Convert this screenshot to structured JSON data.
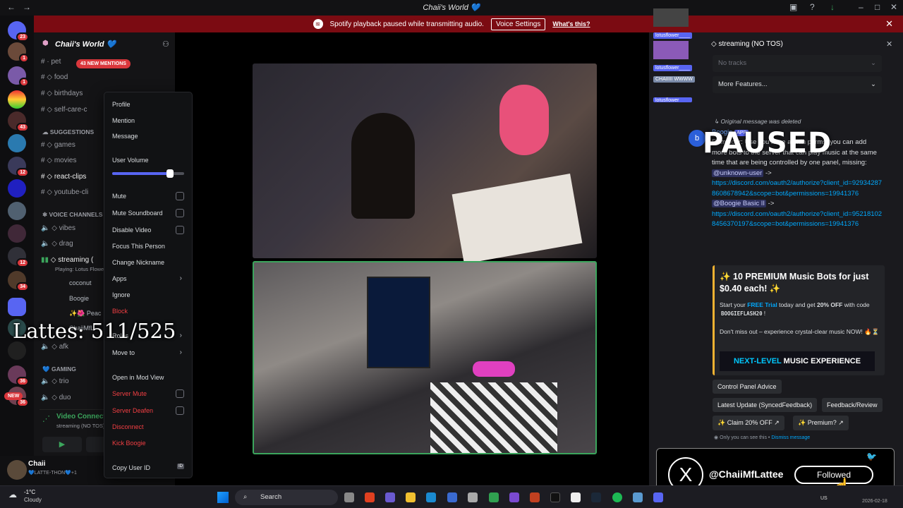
{
  "titlebar": {
    "title": "Chaii's World 💙"
  },
  "notice": {
    "text": "Spotify playback paused while transmitting audio.",
    "button": "Voice Settings",
    "link": "What's this?"
  },
  "server": {
    "name": "Chaii's World 💙",
    "mentions": "43 NEW MENTIONS"
  },
  "rail_badges": [
    "23",
    "1",
    "1",
    "43",
    "12",
    "12",
    "34",
    "36",
    "36",
    "NEW"
  ],
  "channels": {
    "text": [
      "pet",
      "food",
      "birthdays",
      "self-care-c"
    ],
    "cat_suggestions": "SUGGESTIONS",
    "suggestions": [
      "games",
      "movies",
      "react-clips",
      "youtube-cli"
    ],
    "cat_voice": "VOICE CHANNELS",
    "voice": [
      "vibes",
      "drag",
      "streaming (",
      "afk"
    ],
    "streaming_sub": "Playing: Lotus Flowe",
    "users": [
      "coconut",
      "Boogie",
      "✨🌺 Peac",
      "ChaiiMfL"
    ],
    "cat_gaming": "GAMING",
    "gaming": [
      "trio",
      "duo"
    ]
  },
  "voice_connected": {
    "title": "Video Connected",
    "sub": "streaming (NO TOS) / Chai"
  },
  "user": {
    "name": "Chaii",
    "status": "💙LATTE-THON💙+1"
  },
  "menu": {
    "profile": "Profile",
    "mention": "Mention",
    "message": "Message",
    "user_volume": "User Volume",
    "volume": 0.8,
    "mute": "Mute",
    "mute_soundboard": "Mute Soundboard",
    "disable_video": "Disable Video",
    "focus": "Focus This Person",
    "change_nick": "Change Nickname",
    "apps": "Apps",
    "ignore": "Ignore",
    "block": "Block",
    "roles": "Roles",
    "move_to": "Move to",
    "mod_view": "Open in Mod View",
    "server_mute": "Server Mute",
    "server_deafen": "Server Deafen",
    "disconnect": "Disconnect",
    "kick": "Kick Boogie",
    "copy_id": "Copy User ID",
    "id_icon": "ID"
  },
  "overlay": {
    "counter": "Lattes: 511/525",
    "paused": "PAUSED",
    "tag1": "lotusflower____",
    "tag2": "lotusflower____",
    "tag3": "lotusflower____",
    "tag4": "CHAIIIII WWWW"
  },
  "panel": {
    "title": "streaming (NO TOS)",
    "tracks": "No tracks",
    "features": "More Features...",
    "deleted": "Original message was deleted",
    "sender": "Boogie",
    "sender_tag": "APP",
    "msg_body": "Reminder: Use you have admin perms, you can add more bots to the server that can play music at the same time that are being controlled by one panel, missing:",
    "mention1": "@unknown-user",
    "arrow": "->",
    "link1": "https://discord.com/oauth2/authorize?client_id=929342878608678942&scope=bot&permissions=19941376",
    "mention2": "@Boogie Basic II",
    "link2": "https://discord.com/oauth2/authorize?client_id=952181028456370197&scope=bot&permissions=19941376",
    "promo_title": "✨ 10 PREMIUM Music Bots for just $0.40 each! ✨",
    "promo_pre": "Start your ",
    "promo_trial": "FREE Trial",
    "promo_mid": " today and get ",
    "promo_off": "20% OFF",
    "promo_post": " with code ",
    "promo_code": "BOOGIEFLASH20",
    "promo_end": "!",
    "promo_line2": "Don't miss out – experience crystal-clear music NOW! 🔥⏳",
    "banner_a": "NEXT-LEVEL",
    "banner_b": " MUSIC EXPERIENCE",
    "btn_advice": "Control Panel Advice",
    "btn_update": "Latest Update (SyncedFeedback)",
    "btn_feedback": "Feedback/Review",
    "btn_claim": "✨ Claim 20% OFF",
    "btn_premium": "✨ Premium?",
    "only_you": "Only you can see this •",
    "dismiss": "Dismiss message"
  },
  "xcard": {
    "handle": "@ChaiiMfLattee",
    "button": "Followed",
    "logo": "X"
  },
  "taskbar": {
    "weather_temp": "-1°C",
    "weather_desc": "Cloudy",
    "search": "Search",
    "date": "2026-02-18",
    "lang": "US"
  }
}
